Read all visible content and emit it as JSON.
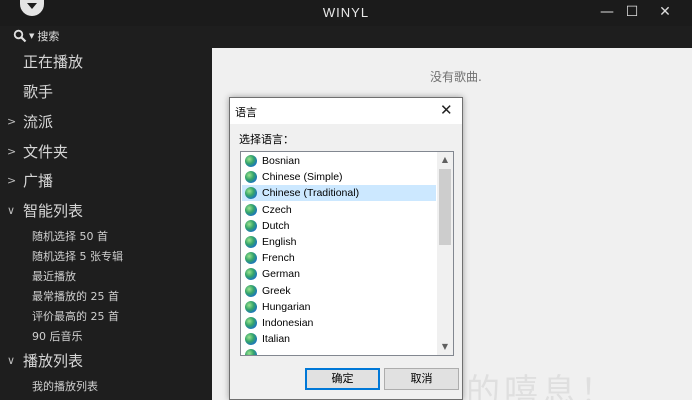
{
  "app": {
    "title": "WINYL",
    "minimize": "—",
    "maximize": "☐",
    "close": "✕"
  },
  "search": {
    "label": "搜索"
  },
  "sidebar": {
    "items": [
      {
        "label": "正在播放",
        "arrow": ""
      },
      {
        "label": "歌手",
        "arrow": ""
      },
      {
        "label": "流派",
        "arrow": ">"
      },
      {
        "label": "文件夹",
        "arrow": ">"
      },
      {
        "label": "广播",
        "arrow": ">"
      },
      {
        "label": "智能列表",
        "arrow": "∨"
      }
    ],
    "smart_lists": [
      "随机选择 50 首",
      "随机选择 5 张专辑",
      "最近播放",
      "最常播放的 25 首",
      "评价最高的 25 首",
      "90 后音乐"
    ],
    "playlists_header": {
      "label": "播放列表",
      "arrow": "∨"
    },
    "playlists": [
      "我的播放列表"
    ]
  },
  "main": {
    "empty_text": "没有歌曲.",
    "watermark": "日开下的嘻息！"
  },
  "dialog": {
    "title": "语言",
    "close": "✕",
    "prompt": "选择语言：",
    "languages": [
      "Bosnian",
      "Chinese (Simple)",
      "Chinese (Traditional)",
      "Czech",
      "Dutch",
      "English",
      "French",
      "German",
      "Greek",
      "Hungarian",
      "Indonesian",
      "Italian"
    ],
    "selected": "Chinese (Traditional)",
    "ok_label": "确定",
    "cancel_label": "取消"
  }
}
